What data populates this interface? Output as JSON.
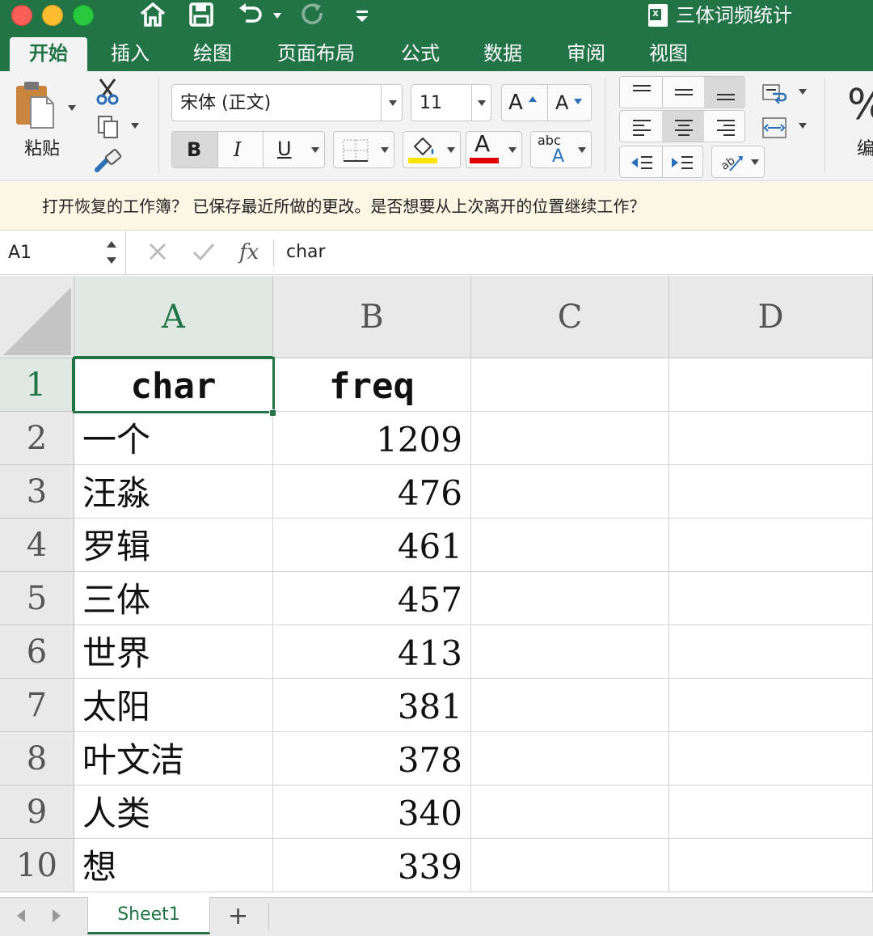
{
  "titlebar": {
    "document_title": "三体词频统计",
    "doc_icon_letter": "X"
  },
  "ribbon_tabs": [
    "开始",
    "插入",
    "绘图",
    "页面布局",
    "公式",
    "数据",
    "审阅",
    "视图"
  ],
  "ribbon": {
    "paste_label": "粘贴",
    "font_name": "宋体 (正文)",
    "font_size": "11",
    "bold": "B",
    "italic": "I",
    "underline": "U",
    "font_color_letter": "A",
    "wrap_abc": "abc",
    "wrap_a": "A",
    "grow_font": "A",
    "shrink_font": "A",
    "edit_label": "编",
    "percent": "%",
    "fill_color": "#ffe400",
    "font_color": "#e00000"
  },
  "notification": {
    "text": "打开恢复的工作簿？ 已保存最近所做的更改。是否想要从上次离开的位置继续工作？"
  },
  "formula_bar": {
    "cell_reference": "A1",
    "fx_label": "fx",
    "content": "char"
  },
  "columns": [
    "A",
    "B",
    "C",
    "D"
  ],
  "rows": [
    {
      "num": "1",
      "a": "char",
      "b": "freq"
    },
    {
      "num": "2",
      "a": "一个",
      "b": "1209"
    },
    {
      "num": "3",
      "a": "汪淼",
      "b": "476"
    },
    {
      "num": "4",
      "a": "罗辑",
      "b": "461"
    },
    {
      "num": "5",
      "a": "三体",
      "b": "457"
    },
    {
      "num": "6",
      "a": "世界",
      "b": "413"
    },
    {
      "num": "7",
      "a": "太阳",
      "b": "381"
    },
    {
      "num": "8",
      "a": "叶文洁",
      "b": "378"
    },
    {
      "num": "9",
      "a": "人类",
      "b": "340"
    },
    {
      "num": "10",
      "a": "想",
      "b": "339"
    }
  ],
  "sheets": [
    "Sheet1"
  ],
  "add_sheet_label": "+",
  "colors": {
    "excel_green": "#227447",
    "notification_bg": "#fbf5e4"
  }
}
